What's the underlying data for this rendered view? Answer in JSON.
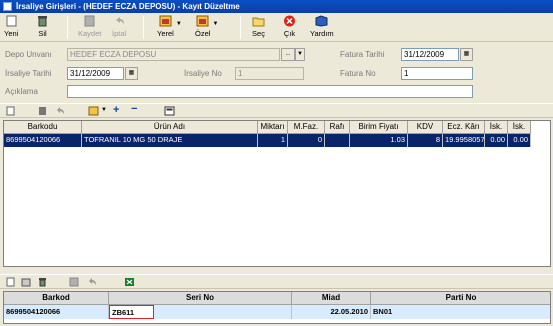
{
  "window": {
    "title": "İrsaliye Girişleri - (HEDEF ECZA DEPOSU) - Kayıt Düzeltme"
  },
  "toolbar": {
    "new": "Yeni",
    "delete": "Sil",
    "save": "Kaydet",
    "cancel": "İptal",
    "local": "Yerel",
    "special": "Özel",
    "select": "Seç",
    "exit": "Çık",
    "help": "Yardım"
  },
  "form": {
    "depot_label": "Depo Unvanı",
    "depot_value": "HEDEF ECZA DEPOSU",
    "depot_picker": "...",
    "invoice_date_label": "Fatura Tarihi",
    "invoice_date_value": "31/12/2009",
    "waybill_date_label": "İrsaliye Tarihi",
    "waybill_date_value": "31/12/2009",
    "waybill_no_label": "İrsaliye No",
    "waybill_no_value": "1",
    "invoice_no_label": "Fatura No",
    "invoice_no_value": "1",
    "description_label": "Açıklama",
    "description_value": ""
  },
  "items_grid": {
    "columns": [
      "Barkodu",
      "Ürün Adı",
      "Miktarı",
      "M.Faz.",
      "Rafı",
      "Birim Fiyatı",
      "KDV",
      "Ecz. Kârı",
      "İsk.",
      "İsk."
    ],
    "rows": [
      [
        "8699504120066",
        "TOFRANIL 10 MG 50 DRAJE",
        "1",
        "0",
        "",
        "1.03",
        "8",
        "19.9958057",
        "0.00",
        "0.00"
      ]
    ]
  },
  "serial_grid": {
    "columns": [
      "Barkod",
      "Seri No",
      "Miad",
      "Parti No"
    ],
    "rows": [
      [
        "8699504120066",
        "ZB611",
        "22.05.2010",
        "BN01"
      ]
    ]
  },
  "colors": {
    "titlebar": "#0b3fa3",
    "selection": "#0a246a",
    "serial_row": "#d9ecff",
    "highlight_border": "#e0202a"
  }
}
